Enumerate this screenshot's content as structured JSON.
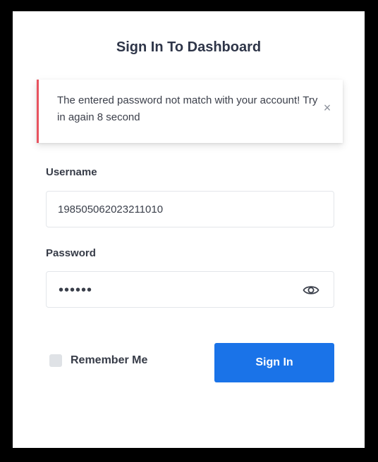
{
  "page": {
    "title": "Sign In To Dashboard"
  },
  "alert": {
    "message": "The entered password not match with your account! Try in again 8 second",
    "close_glyph": "×",
    "accent_color": "#e8535f"
  },
  "form": {
    "username_label": "Username",
    "username_value": "198505062023211010",
    "password_label": "Password",
    "password_mask": "••••••",
    "remember_label": "Remember Me",
    "submit_label": "Sign In"
  },
  "colors": {
    "primary": "#1a73e8",
    "text": "#363b47",
    "border": "#e3e6ea"
  },
  "icons": {
    "close": "close-icon",
    "eye": "eye-icon"
  }
}
